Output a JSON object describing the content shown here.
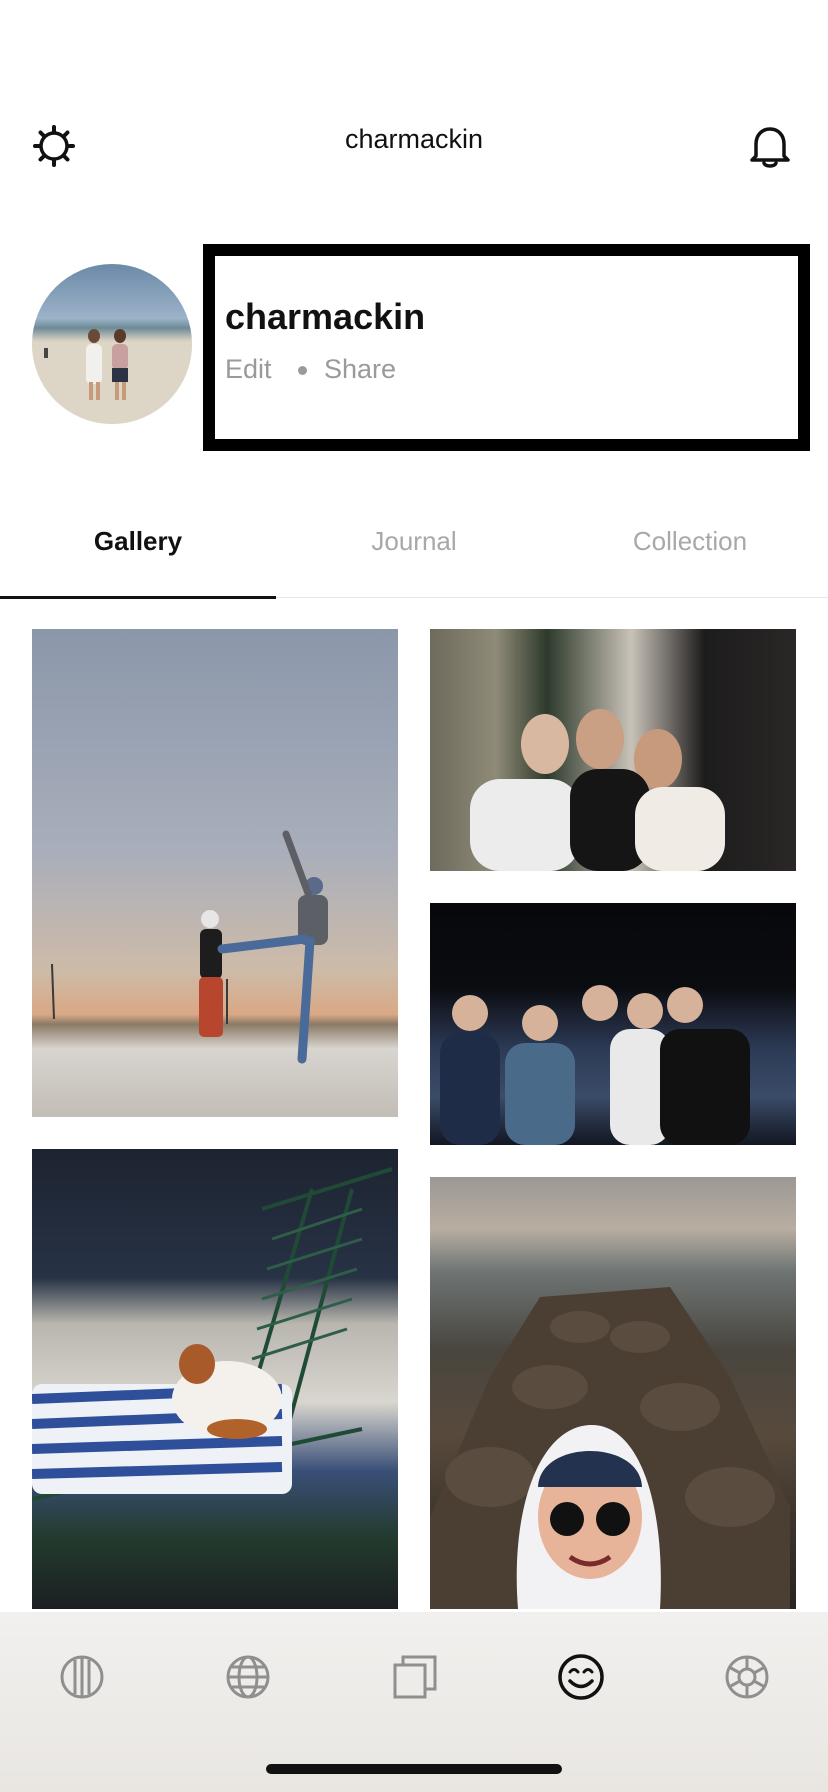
{
  "header": {
    "title": "charmackin",
    "settings_icon": "gear-icon",
    "notifications_icon": "bell-icon"
  },
  "profile": {
    "name": "charmackin",
    "edit_label": "Edit",
    "share_label": "Share",
    "avatar_icon": "avatar"
  },
  "tabs": [
    {
      "label": "Gallery",
      "active": true
    },
    {
      "label": "Journal",
      "active": false
    },
    {
      "label": "Collection",
      "active": false
    }
  ],
  "bottom_nav": {
    "items": [
      {
        "icon": "explore-icon",
        "active": false
      },
      {
        "icon": "globe-icon",
        "active": false
      },
      {
        "icon": "stack-icon",
        "active": false
      },
      {
        "icon": "smiley-icon",
        "active": true
      },
      {
        "icon": "wheel-icon",
        "active": false
      }
    ]
  },
  "colors": {
    "text_primary": "#111111",
    "text_muted": "#9a9a9a",
    "tab_inactive": "#a8a8a8",
    "highlight_border": "#000000"
  }
}
